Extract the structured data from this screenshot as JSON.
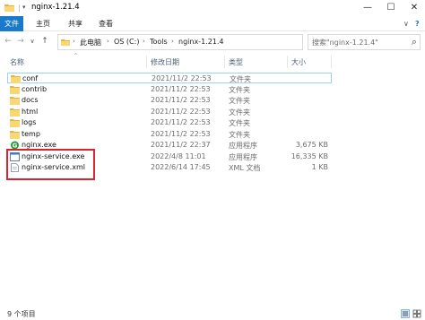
{
  "window": {
    "title": "nginx-1.21.4",
    "quick_access_arrow": "▾",
    "controls": {
      "minimize": "—",
      "maximize": "☐",
      "close": "✕"
    }
  },
  "ribbon": {
    "tabs": [
      "文件",
      "主页",
      "共享",
      "查看"
    ],
    "collapse": "∨",
    "help": "?"
  },
  "nav": {
    "back": "←",
    "forward": "→",
    "recent": "∨",
    "up": "↑",
    "breadcrumb": [
      "此电脑",
      "OS (C:)",
      "Tools",
      "nginx-1.21.4"
    ],
    "separator": "›",
    "dropdown": "∨",
    "refresh": "⟳",
    "search_placeholder": "搜索\"nginx-1.21.4\"",
    "search_icon": "⌕"
  },
  "columns": {
    "name": "名称",
    "date": "修改日期",
    "type": "类型",
    "size": "大小",
    "sort_caret": "^"
  },
  "files": [
    {
      "name": "conf",
      "date": "2021/11/2 22:53",
      "type": "文件夹",
      "size": "",
      "icon": "folder-icon"
    },
    {
      "name": "contrib",
      "date": "2021/11/2 22:53",
      "type": "文件夹",
      "size": "",
      "icon": "folder-icon"
    },
    {
      "name": "docs",
      "date": "2021/11/2 22:53",
      "type": "文件夹",
      "size": "",
      "icon": "folder-icon"
    },
    {
      "name": "html",
      "date": "2021/11/2 22:53",
      "type": "文件夹",
      "size": "",
      "icon": "folder-icon"
    },
    {
      "name": "logs",
      "date": "2021/11/2 22:53",
      "type": "文件夹",
      "size": "",
      "icon": "folder-icon"
    },
    {
      "name": "temp",
      "date": "2021/11/2 22:53",
      "type": "文件夹",
      "size": "",
      "icon": "folder-icon"
    },
    {
      "name": "nginx.exe",
      "date": "2021/11/2 22:37",
      "type": "应用程序",
      "size": "3,675 KB",
      "icon": "nginx-app-icon"
    },
    {
      "name": "nginx-service.exe",
      "date": "2022/4/8 11:01",
      "type": "应用程序",
      "size": "16,335 KB",
      "icon": "exe-app-icon"
    },
    {
      "name": "nginx-service.xml",
      "date": "2022/6/14 17:45",
      "type": "XML 文档",
      "size": "1 KB",
      "icon": "xml-document-icon"
    }
  ],
  "status": {
    "count": "9 个项目"
  },
  "colors": {
    "folder": "#f8d775",
    "folder_dark": "#e3b542",
    "accent": "#1979ca",
    "highlight_box": "#d9232d",
    "selection_border": "#99d1ff",
    "nginx_green": "#1e9a3b"
  }
}
